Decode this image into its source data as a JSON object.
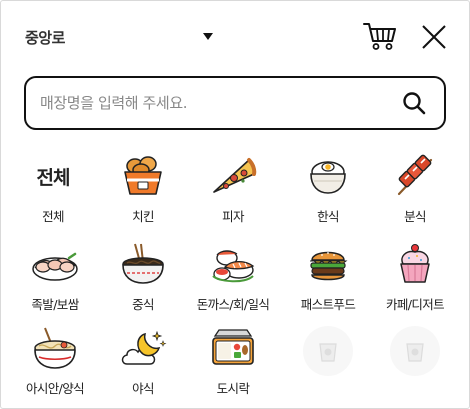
{
  "header": {
    "location": "중앙로",
    "caret_icon": "caret-down-icon",
    "cart_icon": "cart-icon",
    "close_icon": "close-icon"
  },
  "search": {
    "placeholder": "매장명을 입력해 주세요.",
    "icon": "search-icon"
  },
  "categories": [
    {
      "label": "전체",
      "icon_text": "전체",
      "icon": "all-text-icon"
    },
    {
      "label": "치킨",
      "icon": "chicken-icon"
    },
    {
      "label": "피자",
      "icon": "pizza-icon"
    },
    {
      "label": "한식",
      "icon": "rice-bowl-icon"
    },
    {
      "label": "분식",
      "icon": "skewer-icon"
    },
    {
      "label": "족발/보쌈",
      "icon": "pork-icon"
    },
    {
      "label": "중식",
      "icon": "noodles-icon"
    },
    {
      "label": "돈까스/회/일식",
      "icon": "sushi-icon"
    },
    {
      "label": "패스트푸드",
      "icon": "burger-icon"
    },
    {
      "label": "카페/디저트",
      "icon": "cupcake-icon"
    },
    {
      "label": "아시안/양식",
      "icon": "pasta-icon"
    },
    {
      "label": "야식",
      "icon": "moon-icon"
    },
    {
      "label": "도시락",
      "icon": "lunchbox-icon"
    }
  ],
  "placeholders": [
    {
      "icon": "placeholder-cup-icon"
    },
    {
      "icon": "placeholder-cup-icon"
    }
  ],
  "colors": {
    "accent_orange": "#f08a24",
    "border_dark": "#111111",
    "label_text": "#222222"
  }
}
